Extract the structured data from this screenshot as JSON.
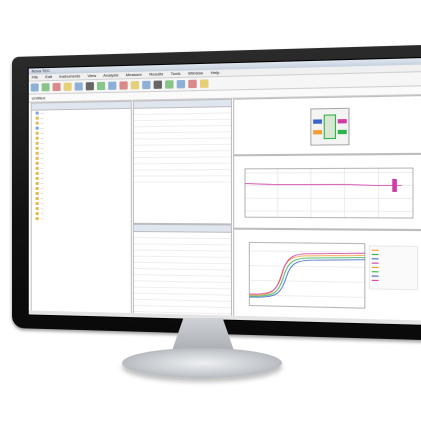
{
  "window": {
    "title_abbrev": "Nova TEC",
    "menu": [
      "File",
      "Edit",
      "Instruments",
      "View",
      "Analysis",
      "Measure",
      "Results",
      "Tools",
      "Window",
      "Help"
    ],
    "tab": "Untitled"
  },
  "left_panel": {
    "header": "",
    "items": [
      {
        "label": "..."
      },
      {
        "label": "..."
      },
      {
        "label": "..."
      },
      {
        "label": "..."
      },
      {
        "label": "..."
      },
      {
        "label": "..."
      },
      {
        "label": "..."
      },
      {
        "label": "..."
      },
      {
        "label": "..."
      },
      {
        "label": "..."
      },
      {
        "label": "..."
      },
      {
        "label": "..."
      },
      {
        "label": "..."
      },
      {
        "label": "..."
      },
      {
        "label": "..."
      },
      {
        "label": "..."
      },
      {
        "label": "..."
      },
      {
        "label": "..."
      },
      {
        "label": "..."
      },
      {
        "label": "..."
      },
      {
        "label": "..."
      },
      {
        "label": "..."
      }
    ]
  },
  "mid_top": {
    "header": "",
    "rows": [
      "",
      "",
      "",
      "",
      "",
      "",
      "",
      "",
      "",
      "",
      "",
      ""
    ]
  },
  "mid_bottom": {
    "header": "",
    "rows": [
      "",
      "",
      "",
      "",
      "",
      "",
      "",
      "",
      "",
      "",
      "",
      "",
      ""
    ]
  },
  "colors": {
    "orange": "#f29b2f",
    "green": "#2db34a",
    "blue": "#3a66c7",
    "pink": "#d23aa6",
    "grid": "#dddddd"
  }
}
